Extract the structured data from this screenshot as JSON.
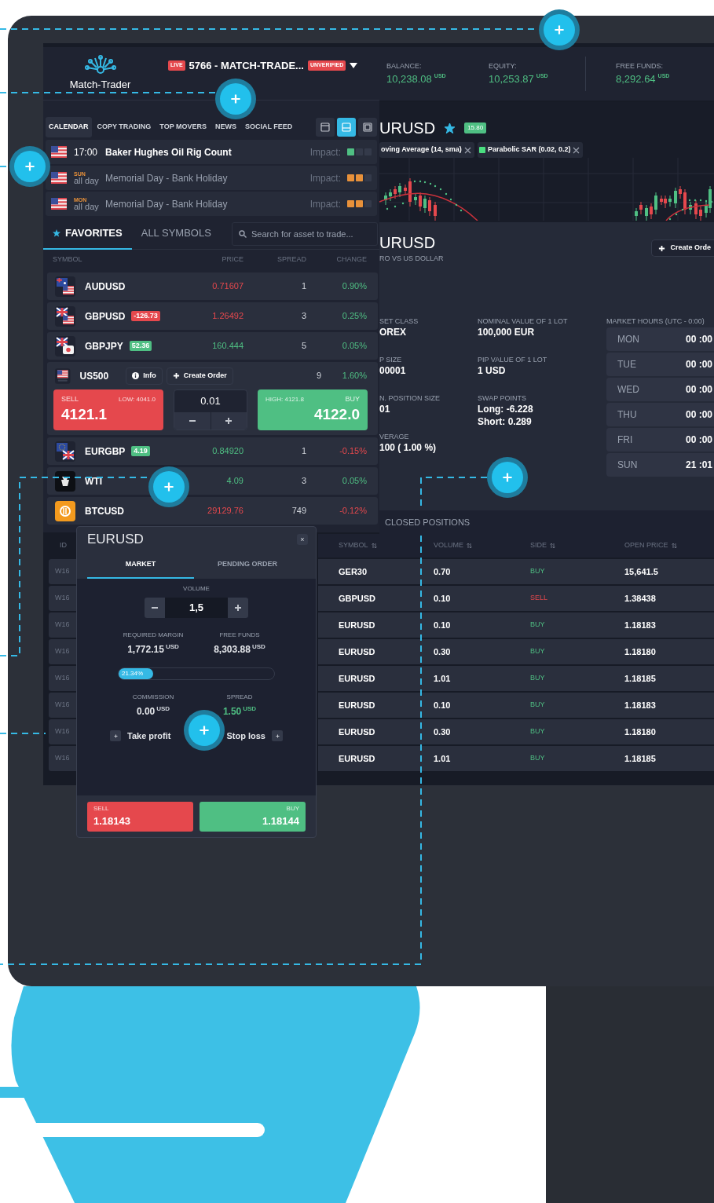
{
  "header": {
    "logo_text": "Match-Trader",
    "live_badge": "LIVE",
    "account": "5766 - MATCH-TRADE...",
    "status_badge": "UNVERIFIED"
  },
  "stats": [
    {
      "label": "BALANCE:",
      "value": "10,238.08",
      "unit": "USD"
    },
    {
      "label": "EQUITY:",
      "value": "10,253.87",
      "unit": "USD"
    },
    {
      "label": "FREE FUNDS:",
      "value": "8,292.64",
      "unit": "USD"
    }
  ],
  "tool_tabs": [
    {
      "label": "CALENDAR",
      "selected": true
    },
    {
      "label": "COPY TRADING",
      "selected": false
    },
    {
      "label": "TOP MOVERS",
      "selected": false
    },
    {
      "label": "NEWS",
      "selected": false
    },
    {
      "label": "SOCIAL FEED",
      "selected": false
    }
  ],
  "layout_buttons": [
    {
      "selected": false
    },
    {
      "selected": true
    },
    {
      "selected": false
    }
  ],
  "events": [
    {
      "time": "17:00",
      "title": "Baker Hughes Oil Rig Count",
      "impact_label": "Impact:",
      "level": 0.33,
      "upcoming": true
    },
    {
      "day": "SUN",
      "time": "all day",
      "title": "Memorial Day - Bank Holiday",
      "impact_label": "Impact:",
      "level": 0.67,
      "upcoming": false
    },
    {
      "day": "MON",
      "time": "all day",
      "title": "Memorial Day - Bank Holiday",
      "impact_label": "Impact:",
      "level": 0.67,
      "upcoming": false
    }
  ],
  "favorites": {
    "tabs": [
      {
        "label": "FAVORITES",
        "selected": true
      },
      {
        "label": "ALL SYMBOLS",
        "selected": false
      }
    ],
    "search_placeholder": "Search for asset to trade...",
    "columns": [
      "SYMBOL",
      "PRICE",
      "SPREAD",
      "CHANGE"
    ],
    "rows": [
      {
        "symbol": "AUDUSD",
        "price": "0.71607",
        "price_up": false,
        "spread": "1",
        "change": "0.90%",
        "change_up": true,
        "expanded": false
      },
      {
        "symbol": "GBPUSD",
        "badge": {
          "text": "-126.73",
          "up": false
        },
        "price": "1.26492",
        "price_up": false,
        "spread": "3",
        "change": "0.25%",
        "change_up": true,
        "expanded": false
      },
      {
        "symbol": "GBPJPY",
        "badge": {
          "text": "52.36",
          "up": true
        },
        "price": "160.444",
        "price_up": true,
        "spread": "5",
        "change": "0.05%",
        "change_up": true,
        "expanded": false
      },
      {
        "symbol": "US500",
        "spread": "9",
        "change": "1.60%",
        "change_up": true,
        "expanded": true,
        "info_button": "Info",
        "create_order_button": "Create Order",
        "sell": {
          "label": "SELL",
          "low": "LOW: 4041.0",
          "price": "4121.1"
        },
        "volume": "0.01",
        "buy": {
          "high": "HIGH: 4121.8",
          "label": "BUY",
          "price": "4122.0"
        }
      },
      {
        "symbol": "EURGBP",
        "badge": {
          "text": "4.19",
          "up": true
        },
        "price": "0.84920",
        "price_up": true,
        "spread": "1",
        "change": "-0.15%",
        "change_up": false,
        "expanded": false
      },
      {
        "symbol": "WTI",
        "price": "4.09",
        "price_up": true,
        "spread": "3",
        "change": "0.05%",
        "change_up": true,
        "expanded": false
      },
      {
        "symbol": "BTCUSD",
        "price": "29129.76",
        "price_up": false,
        "spread": "749",
        "change": "-0.12%",
        "change_up": false,
        "expanded": false
      }
    ]
  },
  "chart": {
    "title": "URUSD",
    "favorite": true,
    "badge": "15.80",
    "indicators": [
      {
        "label": "oving Average (14, sma)"
      },
      {
        "label": "Parabolic SAR (0.02, 0.2)",
        "color": "#4ade80"
      }
    ]
  },
  "instrument": {
    "name": "URUSD",
    "description": "RO VS US DOLLAR",
    "create_order": "Create Orde",
    "details_left": [
      {
        "label": "SET CLASS",
        "lines": [
          "OREX"
        ]
      },
      {
        "label": "P SIZE",
        "lines": [
          "00001"
        ]
      },
      {
        "label": "N. POSITION SIZE",
        "lines": [
          "01"
        ]
      },
      {
        "label": "VERAGE",
        "lines": [
          "100 ( 1.00 %)"
        ]
      }
    ],
    "details_right": [
      {
        "label": "NOMINAL VALUE OF 1 LOT",
        "lines": [
          "100,000 EUR"
        ]
      },
      {
        "label": "PIP VALUE OF 1 LOT",
        "lines": [
          "1 USD"
        ]
      },
      {
        "label": "SWAP POINTS",
        "lines": [
          "Long: -6.228",
          "Short: 0.289"
        ]
      }
    ],
    "market_hours_title": "MARKET HOURS (UTC - 0:00)",
    "market_hours": [
      {
        "day": "MON",
        "time": "00 :00"
      },
      {
        "day": "TUE",
        "time": "00 :00"
      },
      {
        "day": "WED",
        "time": "00 :00"
      },
      {
        "day": "THU",
        "time": "00 :00"
      },
      {
        "day": "FRI",
        "time": "00 :00"
      },
      {
        "day": "SUN",
        "time": "21 :01"
      }
    ]
  },
  "positions": {
    "tab": "CLOSED POSITIONS",
    "id_column": "ID",
    "columns": [
      "SYMBOL",
      "VOLUME",
      "SIDE",
      "OPEN PRICE"
    ],
    "rows": [
      {
        "id": "W16",
        "symbol": "GER30",
        "volume": "0.70",
        "side": "BUY",
        "buy": true,
        "open_price": "15,641.5"
      },
      {
        "id": "W16",
        "symbol": "GBPUSD",
        "volume": "0.10",
        "side": "SELL",
        "buy": false,
        "open_price": "1.38438"
      },
      {
        "id": "W16",
        "symbol": "EURUSD",
        "volume": "0.10",
        "side": "BUY",
        "buy": true,
        "open_price": "1.18183"
      },
      {
        "id": "W16",
        "symbol": "EURUSD",
        "volume": "0.30",
        "side": "BUY",
        "buy": true,
        "open_price": "1.18180"
      },
      {
        "id": "W16",
        "symbol": "EURUSD",
        "volume": "1.01",
        "side": "BUY",
        "buy": true,
        "open_price": "1.18185"
      },
      {
        "id": "W16",
        "symbol": "EURUSD",
        "volume": "0.10",
        "side": "BUY",
        "buy": true,
        "open_price": "1.18183"
      },
      {
        "id": "W16",
        "symbol": "EURUSD",
        "volume": "0.30",
        "side": "BUY",
        "buy": true,
        "open_price": "1.18180"
      },
      {
        "id": "W16",
        "symbol": "EURUSD",
        "volume": "1.01",
        "side": "BUY",
        "buy": true,
        "open_price": "1.18185"
      }
    ]
  },
  "order_ticket": {
    "symbol": "EURUSD",
    "close": "×",
    "tabs": [
      {
        "label": "MARKET",
        "selected": true
      },
      {
        "label": "PENDING ORDER",
        "selected": false
      }
    ],
    "volume_label": "VOLUME",
    "volume": "1,5",
    "required_margin": {
      "label": "REQUIRED MARGIN",
      "value": "1,772.15",
      "unit": "USD"
    },
    "free_funds": {
      "label": "FREE FUNDS",
      "value": "8,303.88",
      "unit": "USD"
    },
    "margin_usage": {
      "level": 0.2134,
      "label": "21.34%"
    },
    "commission": {
      "label": "COMMISSION",
      "value": "0.00",
      "unit": "USD"
    },
    "spread": {
      "label": "SPREAD",
      "value": "1.50",
      "unit": "USD"
    },
    "take_profit": "Take profit",
    "stop_loss": "Stop loss",
    "sell": {
      "label": "SELL",
      "price": "1.18143"
    },
    "buy": {
      "label": "BUY",
      "price": "1.18144"
    }
  }
}
